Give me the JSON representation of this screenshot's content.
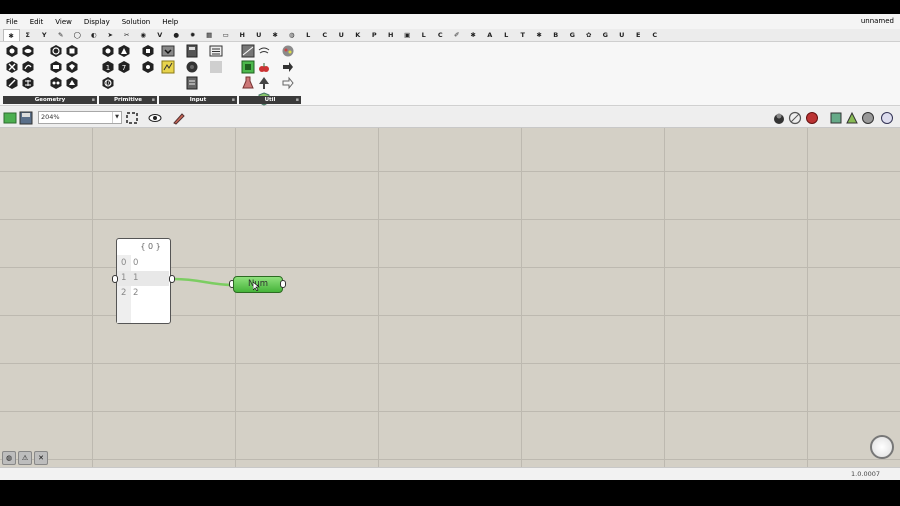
{
  "menu": {
    "items": [
      "File",
      "Edit",
      "View",
      "Display",
      "Solution",
      "Help"
    ],
    "doc_title": "unnamed"
  },
  "tabs": [
    "✱",
    "Σ",
    "Y",
    "✎",
    "◯",
    "◐",
    "➤",
    "✂",
    "◉",
    "V",
    "●",
    "✹",
    "▦",
    "▭",
    "H",
    "U",
    "✱",
    "◍",
    "L",
    "C",
    "U",
    "K",
    "P",
    "H",
    "▣",
    "L",
    "C",
    "✐",
    "✱",
    "A",
    "L",
    "T",
    "✱",
    "B",
    "G",
    "✿",
    "G",
    "U",
    "E",
    "C"
  ],
  "ribbon": {
    "panels": [
      {
        "label": "Geometry"
      },
      {
        "label": "Primitive"
      },
      {
        "label": "Input"
      },
      {
        "label": "Util"
      }
    ]
  },
  "toolbar": {
    "zoom_value": "204%"
  },
  "canvas": {
    "panel_header": "{ 0 }",
    "panel_rows": [
      {
        "index": "0",
        "value": "0"
      },
      {
        "index": "1",
        "value": "1"
      },
      {
        "index": "2",
        "value": "2"
      }
    ],
    "num_label": "Num",
    "footer_buttons": [
      "◍",
      "⚠",
      "✕"
    ]
  },
  "status": {
    "version": "1.0.0007"
  },
  "colors": {
    "canvas_bg": "#d4d0c6",
    "grid": "#bdb9b0",
    "component_green": "#5cc24c",
    "wire": "#7ccd62"
  }
}
